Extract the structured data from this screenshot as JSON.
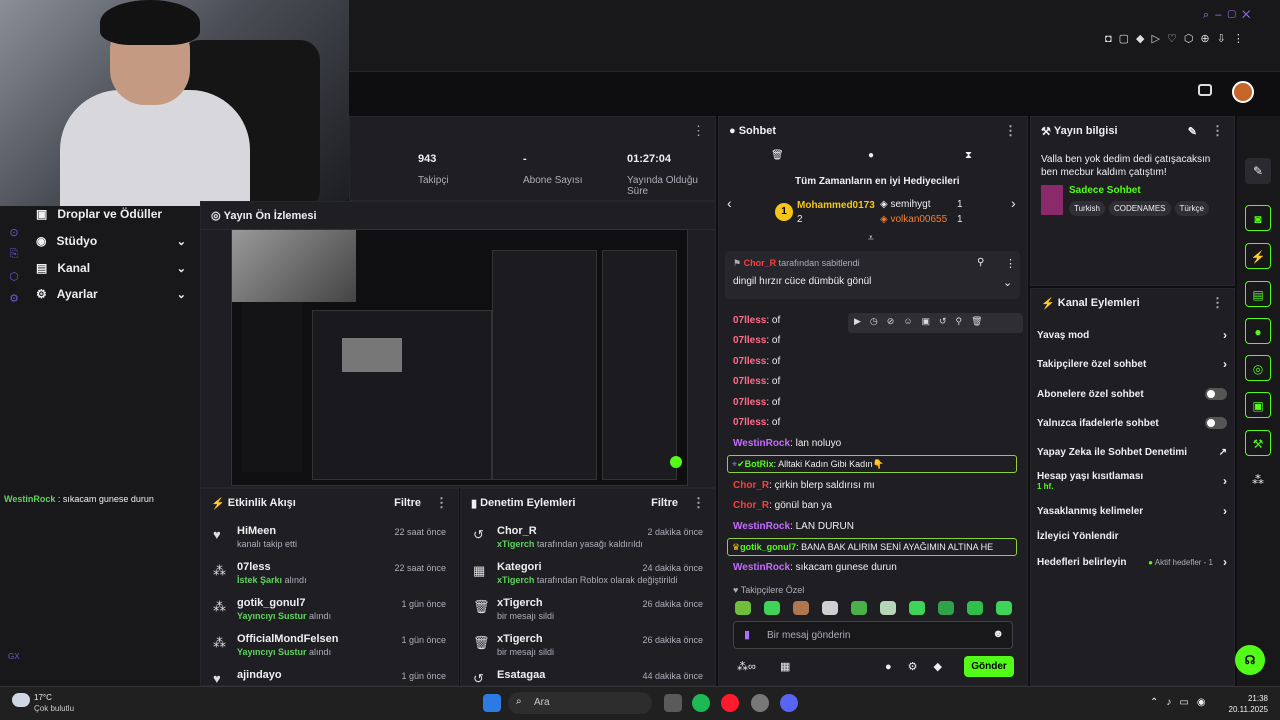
{
  "stats": {
    "followers_value": "943",
    "followers_label": "Takipçi",
    "subs_value": "-",
    "subs_label": "Abone Sayısı",
    "uptime_value": "01:27:04",
    "uptime_label": "Yayında Olduğu",
    "uptime_label2": "Süre"
  },
  "left_nav": {
    "items": [
      {
        "label": "Droplar ve Ödüller"
      },
      {
        "label": "Stüdyo"
      },
      {
        "label": "Kanal"
      },
      {
        "label": "Ayarlar"
      }
    ],
    "bottom_chat": {
      "user": "WestinRock",
      "text": " : sıkacam gunese durun"
    },
    "gx": "GX"
  },
  "preview": {
    "title": "Yayın Ön İzlemesi"
  },
  "activity": {
    "title": "Etkinlik Akışı",
    "filter": "Filtre",
    "items": [
      {
        "name": "HiMeen",
        "sub": "kanalı takip etti",
        "sub_green": "",
        "time": "22 saat önce"
      },
      {
        "name": "07less",
        "sub": "alındı",
        "sub_green": "İstek Şarkı",
        "time": "22 saat önce"
      },
      {
        "name": "gotik_gonul7",
        "sub": "alındı",
        "sub_green": "Yayıncıyı Sustur",
        "time": "1 gün önce"
      },
      {
        "name": "OfficialMondFelsen",
        "sub": "alındı",
        "sub_green": "Yayıncıyı Sustur",
        "time": "1 gün önce"
      },
      {
        "name": "ajindayo",
        "sub": "",
        "sub_green": "",
        "time": "1 gün önce"
      }
    ]
  },
  "moderation": {
    "title": "Denetim Eylemleri",
    "filter": "Filtre",
    "items": [
      {
        "name": "Chor_R",
        "green": "xTigerch",
        "sub": " tarafından yasağı kaldırıldı",
        "time": "2 dakika önce"
      },
      {
        "name": "Kategori",
        "green": "xTigerch",
        "sub": " tarafından Roblox olarak değiştirildi",
        "time": "24 dakika önce"
      },
      {
        "name": "xTigerch",
        "green": "",
        "sub": "bir mesajı sildi",
        "time": "26 dakika önce"
      },
      {
        "name": "xTigerch",
        "green": "",
        "sub": "bir mesajı sildi",
        "time": "26 dakika önce"
      },
      {
        "name": "Esatagaa",
        "green": "",
        "sub": "",
        "time": "44 dakika önce"
      }
    ]
  },
  "chat": {
    "title": "Sohbet",
    "top_gifters_title": "Tüm Zamanların en iyi Hediyecileri",
    "gifters": [
      {
        "name": "Mohammed0173",
        "count": "2"
      },
      {
        "name": "semihygt",
        "count": "1"
      },
      {
        "name": "volkan00655",
        "count": "1"
      }
    ],
    "pinned_by_user": "Chor_R",
    "pinned_by_text": " tarafından sabitlendi",
    "pinned_msg": "dingil hırzır cüce dümbük gönül",
    "messages": [
      {
        "user": "07lless",
        "text": ": of",
        "cls": "u1"
      },
      {
        "user": "07lless",
        "text": ": of",
        "cls": "u1"
      },
      {
        "user": "07lless",
        "text": ": of",
        "cls": "u1"
      },
      {
        "user": "07lless",
        "text": ": of",
        "cls": "u1"
      },
      {
        "user": "07lless",
        "text": ": of",
        "cls": "u1"
      },
      {
        "user": "07lless",
        "text": ": of",
        "cls": "u1"
      },
      {
        "user": "WestinRock",
        "text": ": lan noluyo",
        "cls": "u3"
      },
      {
        "user": "BotRix",
        "text": ": Alltaki Kadın Gibi Kadın👇",
        "cls": "hl"
      },
      {
        "user": "Chor_R",
        "text": ": çirkin blerp saldırısı mı",
        "cls": "u4"
      },
      {
        "user": "Chor_R",
        "text": ": gönül ban ya",
        "cls": "u4"
      },
      {
        "user": "WestinRock",
        "text": ": LAN DURUN",
        "cls": "u3"
      },
      {
        "user": "gotik_gonul7",
        "text": ": BANA BAK ALIRIM SENİ AYAĞIMIN ALTINA HE",
        "cls": "hl"
      },
      {
        "user": "WestinRock",
        "text": ": sıkacam gunese durun",
        "cls": "u3"
      }
    ],
    "emote_section": "Takipçilere Özel",
    "input_placeholder": "Bir mesaj gönderin",
    "send": "Gönder"
  },
  "stream_info": {
    "title": "Yayın bilgisi",
    "stream_title": "Valla ben yok dedim dedi çatışacaksın ben mecbur kaldım çatıştım!",
    "category": "Sadece Sohbet",
    "tags": [
      "Turkish",
      "CODENAMES",
      "Türkçe"
    ]
  },
  "channel_actions": {
    "title": "Kanal Eylemleri",
    "items": [
      {
        "label": "Yavaş mod",
        "kind": "chev"
      },
      {
        "label": "Takipçilere özel sohbet",
        "kind": "chev"
      },
      {
        "label": "Abonelere özel sohbet",
        "kind": "toggle"
      },
      {
        "label": "Yalnızca ifadelerle sohbet",
        "kind": "toggle"
      },
      {
        "label": "Yapay Zeka ile Sohbet Denetimi",
        "kind": "ext"
      },
      {
        "label": "Hesap yaşı kısıtlaması",
        "kind": "chev",
        "sub": "1 hf."
      },
      {
        "label": "Yasaklanmış kelimeler",
        "kind": "chev"
      },
      {
        "label": "İzleyici Yönlendir",
        "kind": "none"
      },
      {
        "label": "Hedefleri belirleyin",
        "kind": "chev",
        "extra": "Aktif hedefler - 1"
      }
    ]
  },
  "taskbar": {
    "temp": "17°C",
    "weather": "Çok bulutlu",
    "search": "Ara",
    "time": "21:38",
    "date": "20.11.2025"
  }
}
